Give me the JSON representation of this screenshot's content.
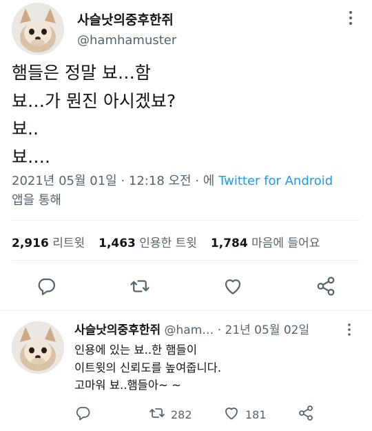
{
  "tweet": {
    "author_name": "사슬낫의중후한쥐",
    "author_handle": "@hamhamuster",
    "text_lines": [
      "햄들은 정말 뵤…함",
      "뵤…가 뭔진 아시겠뵤?",
      "뵤..",
      "뵤…."
    ],
    "timestamp": "2021년 05월 01일 · 12:18 오전 · 에",
    "source": "Twitter for Android",
    "source_suffix": "앱을 통해",
    "stats": {
      "retweets_count": "2,916",
      "retweets_label": "리트윗",
      "quotes_count": "1,463",
      "quotes_label": "인용한 트윗",
      "likes_count": "1,784",
      "likes_label": "마음에 들어요"
    },
    "actions": {
      "reply_icon": "reply-icon",
      "retweet_icon": "retweet-icon",
      "like_icon": "heart-icon",
      "share_icon": "share-icon"
    }
  },
  "reply": {
    "author_name": "사슬낫의중후한쥐",
    "author_handle": "@ham…",
    "date": "· 21년 05월 02일",
    "text_lines": [
      "인용에 있는 뵤..한 햄들이",
      "이트윗의 신뢰도를 높여줍니다.",
      "고마워 뵤..햄들아~ ~"
    ],
    "retweet_count": "282",
    "like_count": "181"
  },
  "colors": {
    "text_primary": "#0f1419",
    "text_secondary": "#536471",
    "link": "#1d9bf0",
    "divider": "#eff3f4"
  }
}
